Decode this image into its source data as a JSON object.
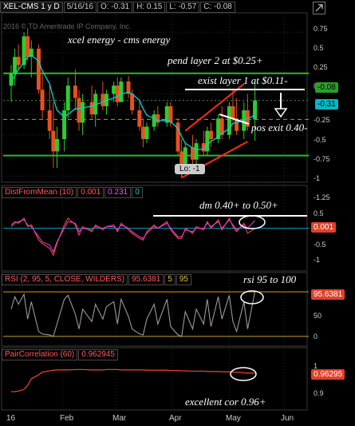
{
  "header": {
    "symbol": "XEL-CMS 1 y D",
    "date": "5/16/16",
    "open": "O: -0.31",
    "high": "H: 0.15",
    "low": "L: -0.57",
    "close": "C: -0.08",
    "watermark": "2016 © TD Ameritrade IP Company, Inc."
  },
  "colors": {
    "candle_up": "#2ecc2e",
    "candle_down": "#e8501f",
    "ma": "#00d4d4",
    "level_line": "#22c022",
    "annotation": "#ffffff"
  },
  "annotations": {
    "title": "xcel energy - cms energy",
    "pend": "pend layer 2 at $0.25+",
    "exist": "exist layer 1 at $0.11-",
    "exit": "pos exit 0.40-",
    "lo_label": "Lo: -1",
    "dm": "dm 0.40+ to 0.50+",
    "rsi": "rsi 95 to 100",
    "cor": "excellent cor 0.96+"
  },
  "price_badges": {
    "last": "-0.08",
    "mid": "-0.31"
  },
  "price_axis": [
    "0.75",
    "0.5",
    "0.25",
    "0",
    "-0.25",
    "-0.5",
    "-0.75",
    "-1",
    "-1.25"
  ],
  "dist_panel": {
    "label": "DistFromMean (10)",
    "v1": "0.001",
    "v2": "0.231",
    "v3": "0",
    "axis": [
      "0.5",
      "0",
      "-0.5",
      "-1"
    ],
    "badge": "0.001"
  },
  "rsi_panel": {
    "label": "RSI (2, 95, 5, CLOSE, WILDERS)",
    "v1": "95.6381",
    "v2": "5",
    "v3": "95",
    "axis": [
      "50",
      "0"
    ],
    "badge": "95.6381"
  },
  "corr_panel": {
    "label": "PairCorrelation (60)",
    "v1": "0.962945",
    "axis": [
      "1",
      "0.9"
    ],
    "badge": "0.96295"
  },
  "x_axis": [
    "16",
    "Feb",
    "Mar",
    "Apr",
    "May",
    "Jun"
  ],
  "chart_data": [
    {
      "type": "candlestick",
      "title": "XEL-CMS 1 y D",
      "ylim": [
        -1.25,
        0.85
      ],
      "x_range": [
        "2016-01-04",
        "2016-06-10"
      ],
      "levels": [
        0.25,
        0.11,
        -0.08,
        -0.31,
        -0.75
      ],
      "low_label": -1,
      "last": {
        "open": -0.31,
        "high": 0.15,
        "low": -0.57,
        "close": -0.08
      },
      "candles": [
        {
          "date": "2016-01-04",
          "o": 0.1,
          "h": 0.35,
          "l": -0.1,
          "c": 0.25
        },
        {
          "date": "2016-01-06",
          "o": 0.25,
          "h": 0.55,
          "l": 0.1,
          "c": 0.45
        },
        {
          "date": "2016-01-08",
          "o": 0.45,
          "h": 0.6,
          "l": 0.3,
          "c": 0.35
        },
        {
          "date": "2016-01-11",
          "o": 0.35,
          "h": 0.75,
          "l": 0.3,
          "c": 0.7
        },
        {
          "date": "2016-01-13",
          "o": 0.7,
          "h": 0.8,
          "l": 0.4,
          "c": 0.45
        },
        {
          "date": "2016-01-15",
          "o": 0.45,
          "h": 0.65,
          "l": 0.2,
          "c": 0.55
        },
        {
          "date": "2016-01-19",
          "o": 0.55,
          "h": 0.6,
          "l": 0.0,
          "c": 0.05
        },
        {
          "date": "2016-01-21",
          "o": 0.05,
          "h": 0.25,
          "l": -0.3,
          "c": -0.2
        },
        {
          "date": "2016-01-25",
          "o": -0.2,
          "h": 0.1,
          "l": -0.55,
          "c": -0.45
        },
        {
          "date": "2016-01-27",
          "o": -0.45,
          "h": -0.1,
          "l": -0.9,
          "c": -0.7
        },
        {
          "date": "2016-01-29",
          "o": -0.7,
          "h": -0.4,
          "l": -0.9,
          "c": -0.55
        },
        {
          "date": "2016-02-02",
          "o": -0.55,
          "h": -0.1,
          "l": -0.7,
          "c": -0.2
        },
        {
          "date": "2016-02-04",
          "o": -0.2,
          "h": 0.2,
          "l": -0.3,
          "c": 0.1
        },
        {
          "date": "2016-02-08",
          "o": 0.1,
          "h": 0.3,
          "l": -0.2,
          "c": -0.05
        },
        {
          "date": "2016-02-10",
          "o": -0.05,
          "h": 0.05,
          "l": -0.45,
          "c": -0.35
        },
        {
          "date": "2016-02-12",
          "o": -0.35,
          "h": 0.0,
          "l": -0.5,
          "c": -0.1
        },
        {
          "date": "2016-02-17",
          "o": -0.1,
          "h": 0.1,
          "l": -0.3,
          "c": -0.25
        },
        {
          "date": "2016-02-19",
          "o": -0.25,
          "h": 0.05,
          "l": -0.4,
          "c": 0.0
        },
        {
          "date": "2016-02-23",
          "o": 0.0,
          "h": 0.15,
          "l": -0.2,
          "c": -0.15
        },
        {
          "date": "2016-02-25",
          "o": -0.15,
          "h": 0.05,
          "l": -0.25,
          "c": 0.0
        },
        {
          "date": "2016-02-29",
          "o": 0.0,
          "h": 0.15,
          "l": -0.1,
          "c": 0.1
        },
        {
          "date": "2016-03-02",
          "o": 0.1,
          "h": 0.2,
          "l": -0.15,
          "c": -0.1
        },
        {
          "date": "2016-03-04",
          "o": -0.1,
          "h": 0.2,
          "l": -0.1,
          "c": 0.15
        },
        {
          "date": "2016-03-08",
          "o": 0.15,
          "h": 0.22,
          "l": -0.05,
          "c": 0.0
        },
        {
          "date": "2016-03-10",
          "o": 0.0,
          "h": 0.05,
          "l": -0.25,
          "c": -0.2
        },
        {
          "date": "2016-03-14",
          "o": -0.2,
          "h": -0.1,
          "l": -0.45,
          "c": -0.4
        },
        {
          "date": "2016-03-16",
          "o": -0.4,
          "h": -0.3,
          "l": -0.65,
          "c": -0.55
        },
        {
          "date": "2016-03-18",
          "o": -0.55,
          "h": -0.35,
          "l": -0.6,
          "c": -0.4
        },
        {
          "date": "2016-03-22",
          "o": -0.4,
          "h": -0.2,
          "l": -0.45,
          "c": -0.25
        },
        {
          "date": "2016-03-24",
          "o": -0.25,
          "h": -0.15,
          "l": -0.4,
          "c": -0.35
        },
        {
          "date": "2016-03-29",
          "o": -0.35,
          "h": -0.1,
          "l": -0.4,
          "c": -0.15
        },
        {
          "date": "2016-03-31",
          "o": -0.15,
          "h": -0.1,
          "l": -0.4,
          "c": -0.35
        },
        {
          "date": "2016-04-04",
          "o": -0.35,
          "h": -0.3,
          "l": -0.75,
          "c": -0.7
        },
        {
          "date": "2016-04-06",
          "o": -0.7,
          "h": -0.55,
          "l": -1.0,
          "c": -0.85
        },
        {
          "date": "2016-04-08",
          "o": -0.85,
          "h": -0.6,
          "l": -0.95,
          "c": -0.65
        },
        {
          "date": "2016-04-12",
          "o": -0.65,
          "h": -0.5,
          "l": -0.85,
          "c": -0.8
        },
        {
          "date": "2016-04-14",
          "o": -0.8,
          "h": -0.55,
          "l": -0.85,
          "c": -0.6
        },
        {
          "date": "2016-04-18",
          "o": -0.6,
          "h": -0.45,
          "l": -0.75,
          "c": -0.7
        },
        {
          "date": "2016-04-20",
          "o": -0.7,
          "h": -0.4,
          "l": -0.75,
          "c": -0.45
        },
        {
          "date": "2016-04-22",
          "o": -0.45,
          "h": -0.35,
          "l": -0.65,
          "c": -0.55
        },
        {
          "date": "2016-04-26",
          "o": -0.55,
          "h": -0.25,
          "l": -0.6,
          "c": -0.3
        },
        {
          "date": "2016-04-28",
          "o": -0.3,
          "h": -0.15,
          "l": -0.55,
          "c": -0.5
        },
        {
          "date": "2016-05-02",
          "o": -0.5,
          "h": -0.1,
          "l": -0.55,
          "c": -0.15
        },
        {
          "date": "2016-05-04",
          "o": -0.15,
          "h": 0.05,
          "l": -0.35,
          "c": -0.3
        },
        {
          "date": "2016-05-06",
          "o": -0.3,
          "h": -0.05,
          "l": -0.5,
          "c": -0.45
        },
        {
          "date": "2016-05-10",
          "o": -0.45,
          "h": -0.1,
          "l": -0.55,
          "c": -0.2
        },
        {
          "date": "2016-05-12",
          "o": -0.2,
          "h": 0.0,
          "l": -0.45,
          "c": -0.4
        },
        {
          "date": "2016-05-16",
          "o": -0.31,
          "h": 0.15,
          "l": -0.57,
          "c": -0.08
        }
      ],
      "ma_values": [
        0.15,
        0.22,
        0.3,
        0.38,
        0.45,
        0.47,
        0.4,
        0.28,
        0.12,
        -0.05,
        -0.2,
        -0.28,
        -0.25,
        -0.18,
        -0.18,
        -0.17,
        -0.15,
        -0.13,
        -0.1,
        -0.08,
        -0.05,
        -0.03,
        0.0,
        0.02,
        0.0,
        -0.08,
        -0.18,
        -0.26,
        -0.3,
        -0.33,
        -0.32,
        -0.34,
        -0.42,
        -0.52,
        -0.6,
        -0.66,
        -0.68,
        -0.67,
        -0.62,
        -0.58,
        -0.52,
        -0.48,
        -0.42,
        -0.36,
        -0.35,
        -0.32,
        -0.3,
        -0.26
      ]
    },
    {
      "type": "line",
      "title": "DistFromMean (10)",
      "ylim": [
        -1.1,
        0.75
      ],
      "series": [
        {
          "name": "DistFromMean",
          "values": [
            0.1,
            0.2,
            0.15,
            0.3,
            0.05,
            0.1,
            -0.35,
            -0.45,
            -0.6,
            -0.8,
            -0.45,
            0.1,
            0.3,
            0.1,
            -0.2,
            0.05,
            -0.1,
            0.1,
            -0.05,
            0.05,
            0.1,
            -0.1,
            0.15,
            -0.05,
            -0.15,
            -0.3,
            -0.35,
            -0.1,
            0.1,
            0.0,
            0.2,
            -0.05,
            -0.3,
            -0.3,
            0.0,
            -0.15,
            0.05,
            -0.05,
            0.2,
            0.0,
            0.25,
            -0.05,
            0.3,
            0.05,
            -0.1,
            0.15,
            -0.15,
            0.001
          ]
        },
        {
          "name": "DistFromMean 2",
          "values": [
            0.05,
            0.15,
            0.2,
            0.25,
            0.1,
            0.05,
            -0.25,
            -0.4,
            -0.5,
            -0.7,
            -0.4,
            0.0,
            0.2,
            0.15,
            -0.1,
            0.0,
            -0.05,
            0.05,
            0.0,
            0.05,
            0.05,
            -0.05,
            0.1,
            0.0,
            -0.1,
            -0.25,
            -0.3,
            -0.15,
            0.05,
            0.0,
            0.15,
            0.0,
            -0.25,
            -0.25,
            -0.05,
            -0.1,
            0.0,
            0.0,
            0.15,
            0.05,
            0.2,
            0.0,
            0.25,
            0.1,
            -0.05,
            0.1,
            0.0,
            0.231
          ]
        }
      ]
    },
    {
      "type": "line",
      "title": "RSI (2, 95, 5, CLOSE, WILDERS)",
      "ylim": [
        0,
        100
      ],
      "levels": [
        95,
        5
      ],
      "series": [
        {
          "name": "RSI",
          "values": [
            60,
            85,
            70,
            90,
            40,
            75,
            15,
            10,
            8,
            5,
            30,
            80,
            88,
            50,
            20,
            60,
            35,
            70,
            40,
            65,
            75,
            30,
            80,
            45,
            20,
            10,
            8,
            40,
            70,
            30,
            80,
            25,
            8,
            5,
            55,
            20,
            60,
            30,
            80,
            25,
            85,
            40,
            88,
            35,
            15,
            75,
            20,
            95.6381
          ]
        }
      ]
    },
    {
      "type": "line",
      "title": "PairCorrelation (60)",
      "ylim": [
        0.86,
        1.0
      ],
      "series": [
        {
          "name": "PairCorrelation",
          "values": [
            0.905,
            0.905,
            0.907,
            0.912,
            0.925,
            0.945,
            0.958,
            0.966,
            0.97,
            0.972,
            0.973,
            0.973,
            0.973,
            0.974,
            0.974,
            0.974,
            0.973,
            0.973,
            0.973,
            0.974,
            0.974,
            0.974,
            0.973,
            0.973,
            0.973,
            0.973,
            0.973,
            0.972,
            0.972,
            0.972,
            0.972,
            0.971,
            0.971,
            0.97,
            0.97,
            0.969,
            0.969,
            0.969,
            0.968,
            0.968,
            0.968,
            0.967,
            0.967,
            0.966,
            0.966,
            0.964,
            0.963,
            0.962945
          ]
        }
      ]
    }
  ]
}
